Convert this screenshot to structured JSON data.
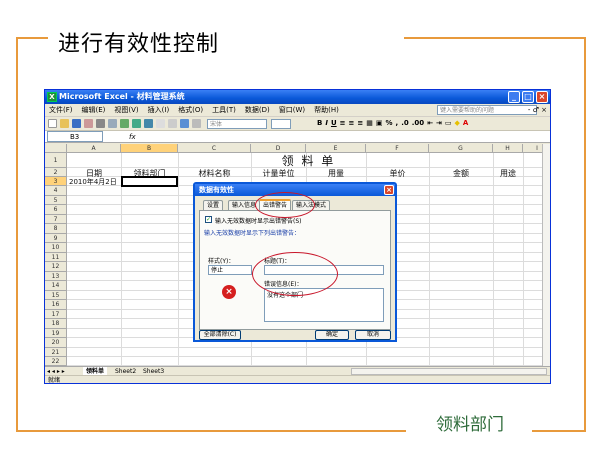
{
  "slide": {
    "title": "进行有效性控制",
    "caption": "领料部门"
  },
  "colors": {
    "accent_orange": "#e89a3c",
    "caption_green": "#2e6b3a",
    "annotation_red": "#c8162a",
    "xp_blue": "#0a58d8"
  },
  "excel": {
    "title": "Microsoft Excel - 材料管理系统",
    "menu": [
      "文件(F)",
      "编辑(E)",
      "视图(V)",
      "插入(I)",
      "格式(O)",
      "工具(T)",
      "数据(D)",
      "窗口(W)",
      "帮助(H)"
    ],
    "help_placeholder": "键入需要帮助的问题",
    "font_name": "宋体",
    "name_box": "B3",
    "fx_label": "fx",
    "columns": [
      "A",
      "B",
      "C",
      "D",
      "E",
      "F",
      "G",
      "H",
      "I"
    ],
    "rows": [
      "1",
      "2",
      "3",
      "4",
      "5",
      "6",
      "7",
      "8",
      "9",
      "10",
      "11",
      "12",
      "13",
      "14",
      "15",
      "16",
      "17",
      "18",
      "19",
      "20",
      "21",
      "22"
    ],
    "cells": {
      "title": "领 料 单",
      "h_date": "日期",
      "h_dept": "领料部门",
      "h_material": "材料名称",
      "h_unit": "计量单位",
      "h_qty": "用量",
      "h_price": "单价",
      "h_amount": "金额",
      "h_use": "用途",
      "a3": "2010年4月2日"
    },
    "sheet_tabs": [
      "领料单",
      "Sheet2",
      "Sheet3"
    ],
    "status": "就绪"
  },
  "dialog": {
    "title": "数据有效性",
    "tabs": [
      "设置",
      "输入信息",
      "出错警告",
      "输入法模式"
    ],
    "active_tab": "出错警告",
    "checkbox_label": "输入无效数据时显示出错警告(S)",
    "checkbox_checked": true,
    "subtitle": "输入无效数据时显示下列出错警告：",
    "style_label": "样式(Y)：",
    "style_value": "停止",
    "title_label": "标题(T)：",
    "title_value": "",
    "error_label": "错误信息(E)：",
    "error_value": "没有这个部门",
    "clear_button": "全部清除(C)",
    "ok_button": "确定",
    "cancel_button": "取消"
  }
}
